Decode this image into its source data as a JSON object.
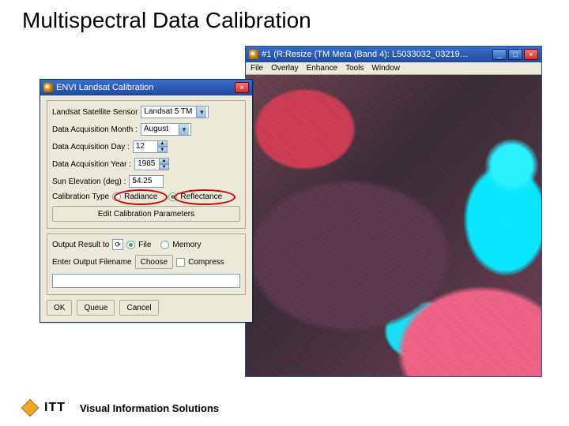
{
  "slide": {
    "title": "Multispectral Data Calibration"
  },
  "footer": {
    "company": "ITT",
    "tagline": "Visual Information Solutions"
  },
  "viewer": {
    "title": "#1 (R:Resize (TM Meta (Band 4): L5033032_03219…",
    "menus": [
      "File",
      "Overlay",
      "Enhance",
      "Tools",
      "Window"
    ]
  },
  "dialog": {
    "title": "ENVI Landsat Calibration",
    "fields": {
      "sensor_label": "Landsat Satellite Sensor",
      "sensor_value": "Landsat 5 TM",
      "month_label": "Data Acquisition Month :",
      "month_value": "August",
      "day_label": "Data Acquisition Day :",
      "day_value": "12",
      "year_label": "Data Acquisition Year :",
      "year_value": "1985",
      "sun_label": "Sun Elevation (deg) :",
      "sun_value": "54.25",
      "caltype_label": "Calibration Type",
      "radiance_label": "Radiance",
      "reflectance_label": "Reflectance"
    },
    "edit_cal_btn": "Edit Calibration Parameters",
    "output": {
      "result_label": "Output Result to",
      "file_label": "File",
      "memory_label": "Memory",
      "filename_label": "Enter Output Filename",
      "choose_btn": "Choose",
      "compress_label": "Compress",
      "filename_value": ""
    },
    "buttons": {
      "ok": "OK",
      "queue": "Queue",
      "cancel": "Cancel"
    }
  }
}
